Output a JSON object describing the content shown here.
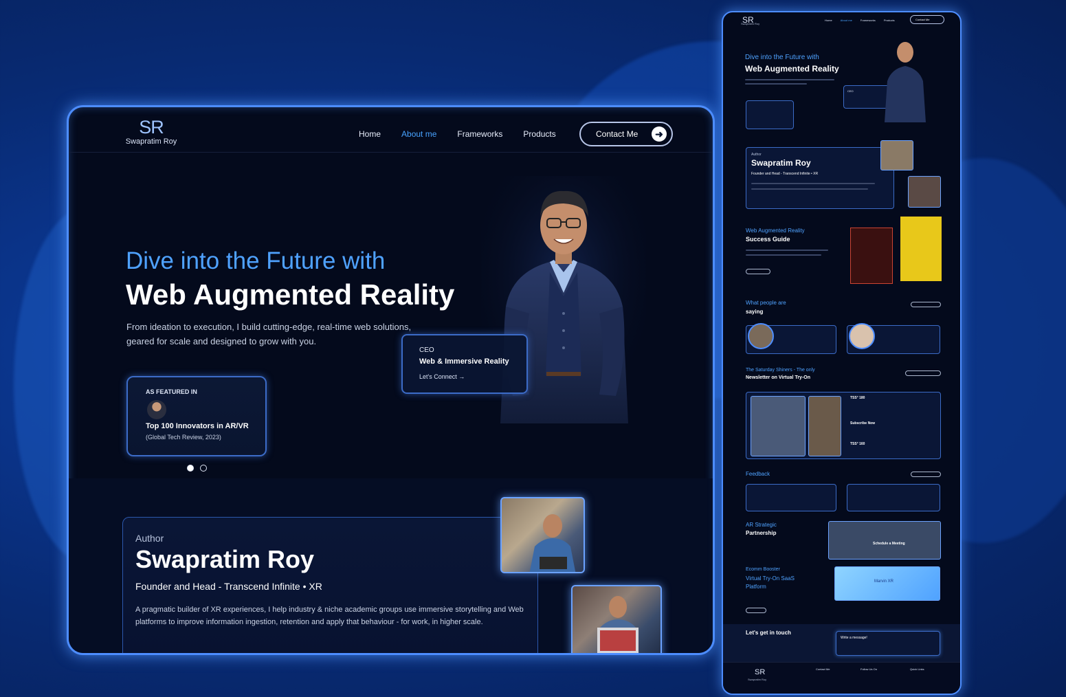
{
  "brand": {
    "mark": "SR",
    "name": "Swapratim Roy"
  },
  "nav": {
    "items": [
      {
        "label": "Home",
        "active": false
      },
      {
        "label": "About me",
        "active": true
      },
      {
        "label": "Frameworks",
        "active": false
      },
      {
        "label": "Products",
        "active": false
      }
    ],
    "contact_label": "Contact Me",
    "contact_icon": "arrow-right-icon"
  },
  "hero": {
    "subtitle": "Dive into the Future with",
    "title": "Web Augmented Reality",
    "description": "From ideation to execution, I build cutting-edge, real-time web solutions, geared for scale and designed to grow with you."
  },
  "featured": {
    "label": "AS FEATURED IN",
    "title": "Top 100 Innovators in AR/VR",
    "note": "(Global Tech Review, 2023)",
    "slides": 2,
    "active_slide": 1
  },
  "ceo_card": {
    "role": "CEO",
    "title": "Web & Immersive Reality",
    "link": "Let's Connect"
  },
  "author": {
    "label": "Author",
    "name": "Swapratim Roy",
    "role": "Founder and Head - Transcend Infinite • XR",
    "bio": "A pragmatic builder of XR experiences, I help industry & niche academic groups use immersive storytelling and Web platforms to improve information ingestion, retention and apply that behaviour - for work, in higher scale."
  },
  "mobile": {
    "nav": [
      "Home",
      "About me",
      "Frameworks",
      "Products"
    ],
    "contact_label": "Contact Me",
    "hero_sub": "Dive into the Future with",
    "hero_title": "Web Augmented Reality",
    "ceo_card": "CEO",
    "author_label": "Author",
    "author_name": "Swapratim Roy",
    "author_role": "Founder and Head - Transcend Infinite • XR",
    "guide_sub": "Web Augmented Reality",
    "guide_title": "Success Guide",
    "testimonials_title": [
      "What people are",
      "saying"
    ],
    "newsletter_title": [
      "The Saturday Shiners - The only",
      "Newsletter on Virtual Try-On"
    ],
    "newsletter_items": [
      "TSS° 180",
      "Subscribe Now",
      "TSS° 160"
    ],
    "feedback_title": "Feedback",
    "partnership_title": [
      "AR Strategic",
      "Partnership"
    ],
    "partnership_cta": "Schedule a Meeting",
    "ecomm_title": [
      "Ecomm Booster",
      "Virtual Try-On SaaS",
      "Platform"
    ],
    "ecomm_screen": "Marvin XR",
    "touch_title": "Let's get in touch",
    "message_placeholder": "Write a message!",
    "footer_cols": [
      "Contact Me",
      "Follow Us On",
      "Quick Links"
    ],
    "footer_logo": "SR",
    "footer_name": "Swapratim Roy"
  },
  "colors": {
    "background": "#0a3388",
    "accent": "#4fa2ff",
    "frame_border": "#4d8dff",
    "panel": "#040a1c"
  }
}
